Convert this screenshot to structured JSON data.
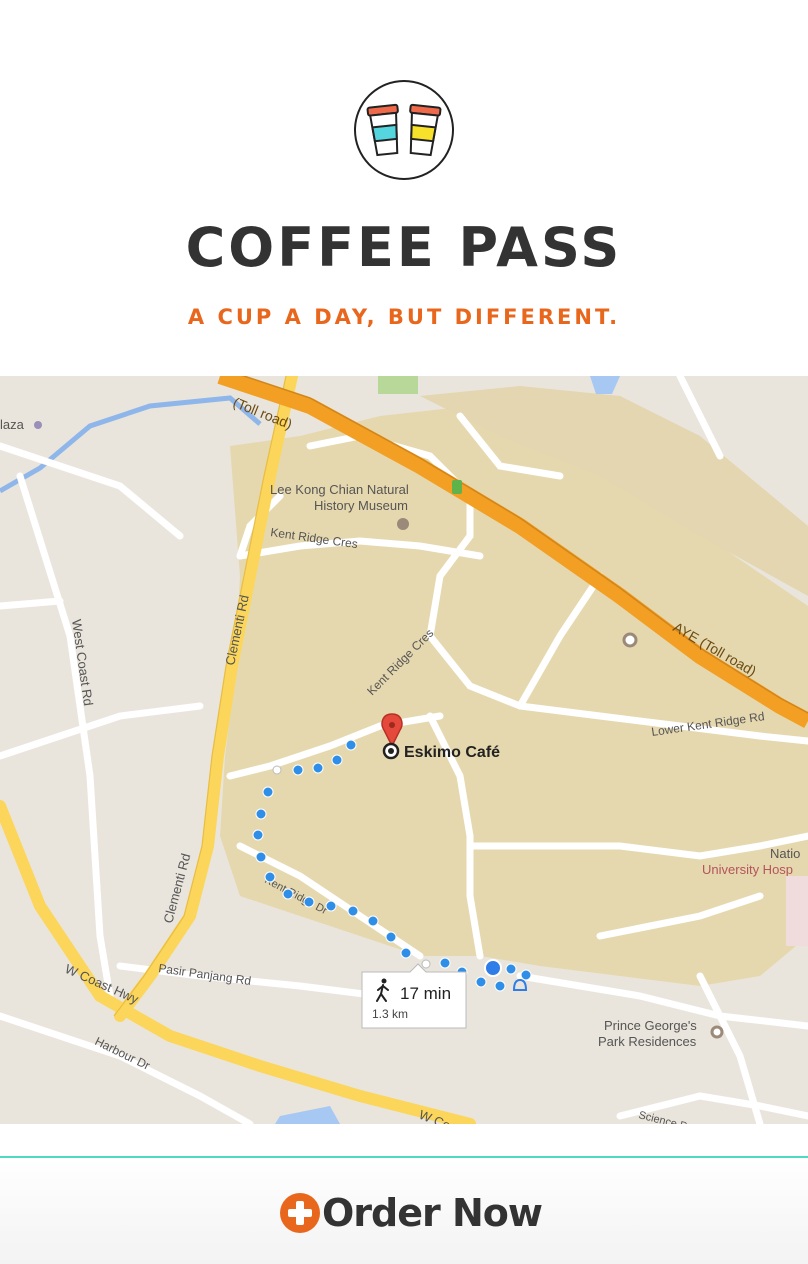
{
  "app": {
    "title": "COFFEE PASS",
    "tagline": "A CUP A DAY, BUT DIFFERENT."
  },
  "map": {
    "labels": {
      "toll_road_top": "(Toll road)",
      "plaza": "laza",
      "museum_line1": "Lee Kong Chian Natural",
      "museum_line2": "History Museum",
      "kent_ridge_cres": "Kent Ridge Cres",
      "kent_ridge_cres_2": "Kent Ridge Cres",
      "clementi_rd": "Clementi Rd",
      "clementi_rd_2": "Clementi Rd",
      "west_coast_rd": "West Coast Rd",
      "aye": "AYE (Toll road)",
      "lower_kent_ridge": "Lower Kent Ridge Rd",
      "destination": "Eskimo Café",
      "hospital_1": "Natio",
      "hospital_2": "University Hosp",
      "kent_ridge_dr": "Kent Ridge Dr",
      "pasir_panjang": "Pasir Panjang Rd",
      "w_coast_hwy": "W Coast Hwy",
      "w_coast_hwy_2": "W Co",
      "harbour_dr": "Harbour Dr",
      "pgpr_1": "Prince George's",
      "pgpr_2": "Park Residences",
      "science_park": "Science Park Rd"
    },
    "route": {
      "mode": "walking",
      "duration": "17 min",
      "distance": "1.3 km"
    },
    "colors": {
      "land": "#e9e5dc",
      "campus": "#e6d8ae",
      "highway": "#f29f24",
      "major_road": "#fbd65b",
      "route": "#2f8ee8",
      "pin": "#e4493b"
    }
  },
  "cta": {
    "label": "Order Now",
    "icon": "plus-circle-icon",
    "accent": "#e8671c",
    "divider": "#4fd8c4"
  }
}
